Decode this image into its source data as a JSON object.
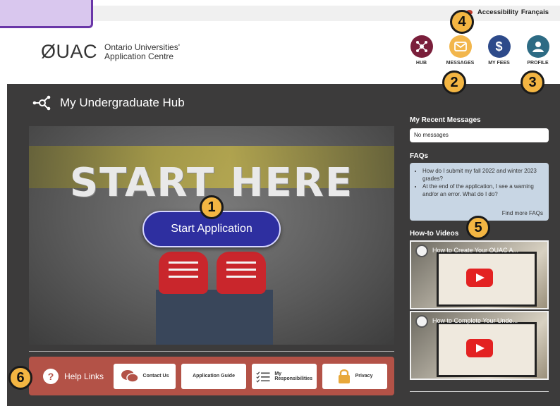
{
  "top_links": {
    "accessibility": "Accessibility",
    "language": "Français"
  },
  "logo": {
    "mark": "ØUAC",
    "line1": "Ontario Universities'",
    "line2": "Application Centre"
  },
  "nav": [
    {
      "label": "HUB",
      "icon": "hub-icon"
    },
    {
      "label": "MESSAGES",
      "icon": "envelope-icon"
    },
    {
      "label": "MY FEES",
      "icon": "dollar-icon"
    },
    {
      "label": "PROFILE",
      "icon": "user-icon"
    }
  ],
  "hub": {
    "title": "My Undergraduate Hub"
  },
  "hero": {
    "text": "START HERE",
    "button": "Start Application"
  },
  "help": {
    "label": "Help Links",
    "buttons": [
      "Contact Us",
      "Application Guide",
      "My Responsibilities",
      "Privacy"
    ]
  },
  "sidebar": {
    "messages_title": "My Recent Messages",
    "messages_value": "No messages",
    "faq_title": "FAQs",
    "faqs": [
      "How do I submit my fall 2022 and winter 2023 grades?",
      "At the end of the application, I see a warning and/or an error. What do I do?"
    ],
    "faq_more": "Find more FAQs",
    "videos_title": "How-to Videos",
    "videos": [
      "How to Create Your OUAC A...",
      "How to Complete Your Unde..."
    ]
  },
  "callouts": [
    "1",
    "2",
    "3",
    "4",
    "5",
    "6"
  ],
  "colors": {
    "hub_bg": "#3c3b3b",
    "accent_button": "#2e2fa0",
    "help_bar": "#b35247",
    "callout": "#f3b542"
  }
}
